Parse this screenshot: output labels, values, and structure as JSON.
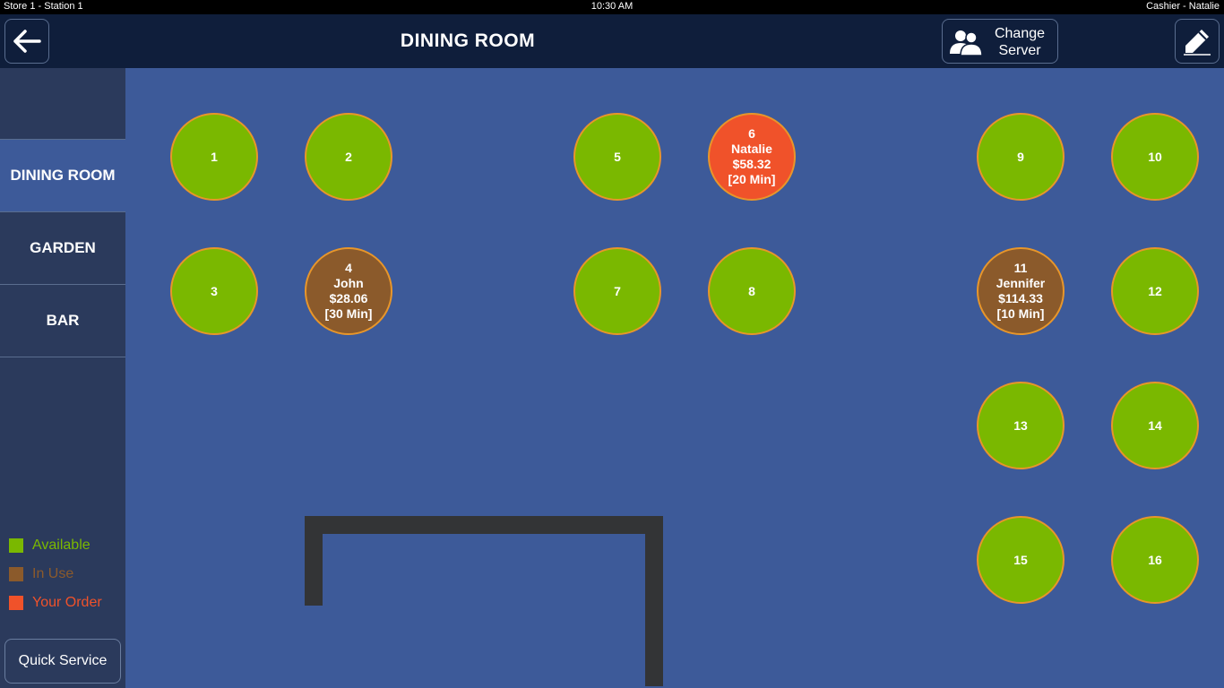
{
  "status": {
    "left": "Store 1 - Station 1",
    "time": "10:30 AM",
    "right": "Cashier - Natalie"
  },
  "header": {
    "title": "DINING ROOM",
    "change_server_line1": "Change",
    "change_server_line2": "Server"
  },
  "sidebar": {
    "items": [
      {
        "label": "DINING ROOM",
        "active": true
      },
      {
        "label": "GARDEN",
        "active": false
      },
      {
        "label": "BAR",
        "active": false
      }
    ],
    "quick_service": "Quick Service"
  },
  "legend": [
    {
      "label": "Available",
      "color": "#7ab800"
    },
    {
      "label": "In Use",
      "color": "#8b5a2b"
    },
    {
      "label": "Your Order",
      "color": "#f0522a"
    }
  ],
  "tables": [
    {
      "number": "1",
      "status": "available"
    },
    {
      "number": "2",
      "status": "available"
    },
    {
      "number": "3",
      "status": "available"
    },
    {
      "number": "4",
      "status": "inuse",
      "server": "John",
      "amount": "$28.06",
      "time": "[30 Min]"
    },
    {
      "number": "5",
      "status": "available"
    },
    {
      "number": "6",
      "status": "yours",
      "server": "Natalie",
      "amount": "$58.32",
      "time": "[20 Min]"
    },
    {
      "number": "7",
      "status": "available"
    },
    {
      "number": "8",
      "status": "available"
    },
    {
      "number": "9",
      "status": "available"
    },
    {
      "number": "10",
      "status": "available"
    },
    {
      "number": "11",
      "status": "inuse",
      "server": "Jennifer",
      "amount": "$114.33",
      "time": "[10 Min]"
    },
    {
      "number": "12",
      "status": "available"
    },
    {
      "number": "13",
      "status": "available"
    },
    {
      "number": "14",
      "status": "available"
    },
    {
      "number": "15",
      "status": "available"
    },
    {
      "number": "16",
      "status": "available"
    }
  ],
  "colors": {
    "available": "#7ab800",
    "in_use": "#8b5a2b",
    "your_order": "#f0522a",
    "table_border": "#e8962a",
    "floor": "#3d5a99",
    "header": "#0f1e3b",
    "sidebar": "#2b3a5c"
  }
}
